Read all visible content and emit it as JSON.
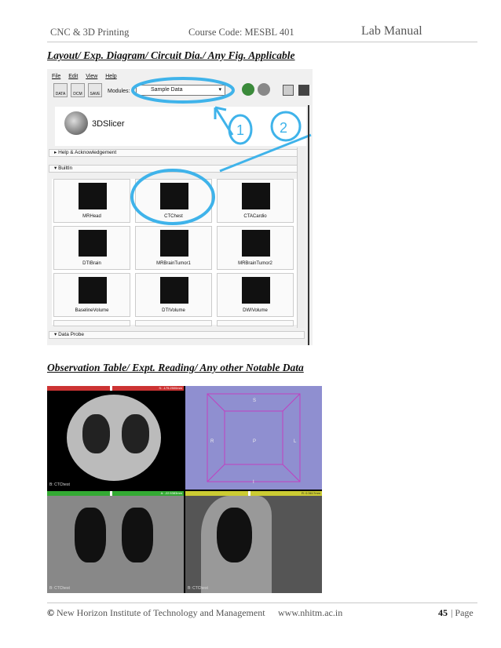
{
  "header": {
    "left": "CNC & 3D Printing",
    "center": "Course Code: MESBL 401",
    "right": "Lab Manual"
  },
  "section1": "Layout/ Exp. Diagram/ Circuit Dia./ Any Fig. Applicable",
  "section2": "Observation Table/ Expt. Reading/ Any other Notable Data",
  "slicer": {
    "menu": [
      "File",
      "Edit",
      "View",
      "Help"
    ],
    "toolbar": [
      "DATA",
      "DCM",
      "SAVE"
    ],
    "modules_label": "Modules:",
    "modules_value": "Sample Data",
    "logo_text": "3DSlicer",
    "help_label": "Help & Acknowledgement",
    "builtin_label": "BuiltIn",
    "tiles": [
      "MRHead",
      "CTChest",
      "CTACardio",
      "DTIBrain",
      "MRBrainTumor1",
      "MRBrainTumor2",
      "BaselineVolume",
      "DTIVolume",
      "DWIVolume"
    ],
    "data_probe": "Data Probe",
    "annotation1": "1",
    "annotation2": "2"
  },
  "viewer": {
    "axial_value": "S: -175.2500mm",
    "coronal_value": "A: -22.5383mm",
    "sagittal_value": "R: 0.3617mm",
    "axial_label": "B: CTChest",
    "coronal_label": "B: CTChest",
    "sagittal_label": "B: CTChest",
    "cube_labels": {
      "s": "S",
      "i": "I",
      "r": "R",
      "l": "L",
      "p": "P"
    }
  },
  "footer": {
    "copy": "©",
    "institute": "New Horizon Institute of Technology and Management",
    "website": "www.nhitm.ac.in",
    "page_number": "45",
    "page_label": "| Page"
  }
}
